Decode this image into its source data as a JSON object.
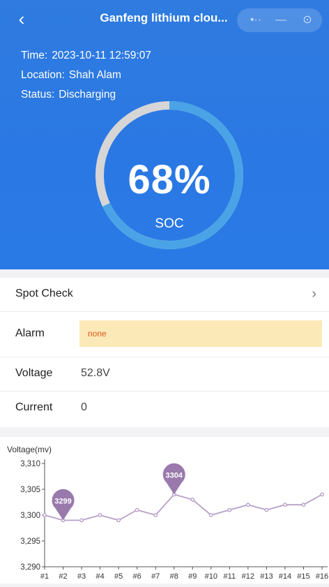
{
  "header": {
    "back_icon": "‹",
    "title": "Ganfeng lithium clou...",
    "capsule": {
      "more_icon": "•··",
      "minus_icon": "—",
      "close_icon": "⊙"
    },
    "time_label": "Time:",
    "time_value": "2023-10-11 12:59:07",
    "location_label": "Location:",
    "location_value": "Shah Alam",
    "status_label": "Status:",
    "status_value": "Discharging",
    "soc_value": "68%",
    "soc_fraction": 0.68,
    "soc_label": "SOC"
  },
  "details": {
    "spot_check": {
      "label": "Spot Check",
      "chevron": "›"
    },
    "alarm": {
      "label": "Alarm",
      "value": "none"
    },
    "voltage": {
      "label": "Voltage",
      "value": "52.8V"
    },
    "current": {
      "label": "Current",
      "value": "0"
    }
  },
  "colors": {
    "primary": "#2a78e4",
    "gauge_track": "#d6d6d6",
    "gauge_fill": "#4aa3e6",
    "alarm_bg": "#fbe9b7",
    "alarm_text": "#e0561d",
    "series": "#b7a0c8",
    "marker": "#9a79ad"
  },
  "chart_data": {
    "type": "line",
    "ylabel": "Voltage(mv)",
    "categories": [
      "#1",
      "#2",
      "#3",
      "#4",
      "#5",
      "#6",
      "#7",
      "#8",
      "#9",
      "#10",
      "#11",
      "#12",
      "#13",
      "#14",
      "#15",
      "#16"
    ],
    "y_ticks": [
      "3,290",
      "3,295",
      "3,300",
      "3,305",
      "3,310"
    ],
    "ylim": [
      3290,
      3310
    ],
    "series": [
      {
        "values": [
          3300,
          3299,
          3299,
          3300,
          3299,
          3301,
          3300,
          3304,
          3303,
          3300,
          3301,
          3302,
          3301,
          3302,
          3302,
          3304
        ]
      }
    ],
    "markers": [
      {
        "category": "#2",
        "value": 3299,
        "label": "3299"
      },
      {
        "category": "#8",
        "value": 3304,
        "label": "3304"
      }
    ]
  }
}
